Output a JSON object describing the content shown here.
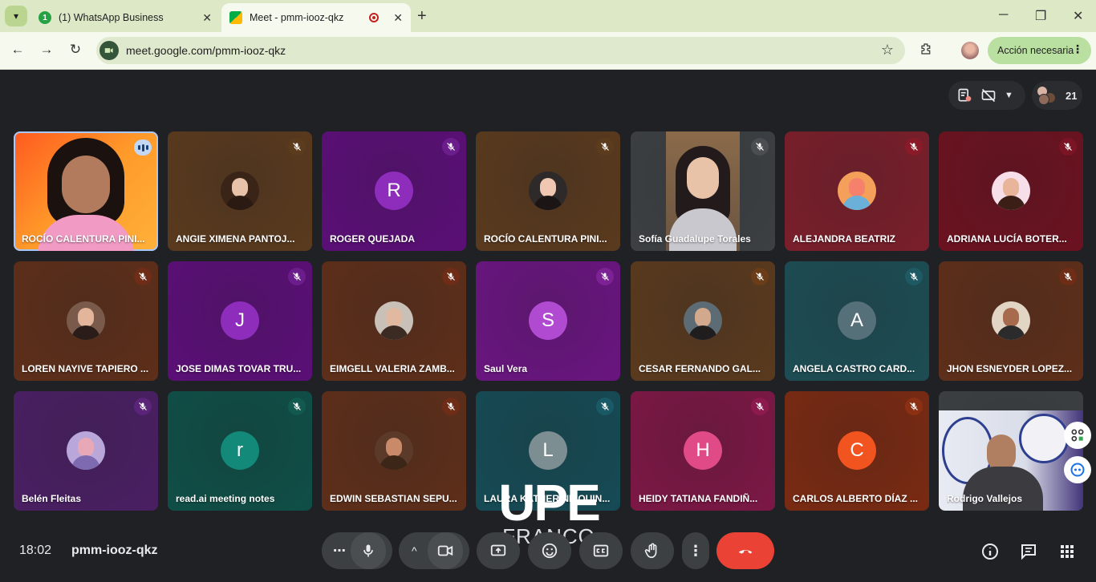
{
  "browser": {
    "tabs": [
      {
        "title": "(1) WhatsApp Business",
        "favicon_badge": "1"
      },
      {
        "title": "Meet - pmm-iooz-qkz"
      }
    ],
    "url": "meet.google.com/pmm-iooz-qkz",
    "action_button": "Acción necesaria"
  },
  "meet": {
    "participant_count": "21",
    "time": "18:02",
    "code": "pmm-iooz-qkz"
  },
  "tiles": [
    {
      "name": "ROCÍO CALENTURA PINI...",
      "bg": "#ff8a1f",
      "kind": "video-main"
    },
    {
      "name": "ANGIE XIMENA PANTOJ...",
      "bg": "#5a3a1e",
      "kind": "photo",
      "mic": "#5c3c1d"
    },
    {
      "name": "ROGER QUEJADA",
      "bg": "#5b0f77",
      "kind": "letter",
      "letter": "R",
      "avatar_color": "#8e2dbb",
      "mic": "#6c1d8c"
    },
    {
      "name": "ROCÍO CALENTURA PINI...",
      "bg": "#5a3a1e",
      "kind": "photo",
      "mic": "#5c3c1d"
    },
    {
      "name": "Sofía Guadalupe Torales",
      "bg": "#3c4043",
      "kind": "video-side",
      "mic": "#4a4d51"
    },
    {
      "name": "ALEJANDRA BEATRIZ",
      "bg": "#7a1f2b",
      "kind": "photo",
      "mic": "#8a1a28"
    },
    {
      "name": "ADRIANA LUCÍA BOTER...",
      "bg": "#6c1220",
      "kind": "photo",
      "mic": "#7b1424"
    },
    {
      "name": "LOREN NAYIVE TAPIERO ...",
      "bg": "#5e2f1a",
      "kind": "photo",
      "mic": "#6f2c17"
    },
    {
      "name": "JOSE DIMAS TOVAR TRU...",
      "bg": "#5b0f77",
      "kind": "letter",
      "letter": "J",
      "avatar_color": "#8e2dbb",
      "mic": "#6c1d8c"
    },
    {
      "name": "EIMGELL VALERIA ZAMB...",
      "bg": "#5e2f1a",
      "kind": "photo",
      "mic": "#6f2c17"
    },
    {
      "name": "Saul Vera",
      "bg": "#6a1580",
      "kind": "letter",
      "letter": "S",
      "avatar_color": "#b04bd1",
      "mic": "#7c2295"
    },
    {
      "name": "CESAR FERNANDO GAL...",
      "bg": "#5a3a1e",
      "kind": "photo",
      "mic": "#6a3c17"
    },
    {
      "name": "ANGELA CASTRO CARD...",
      "bg": "#1d4d54",
      "kind": "letter",
      "letter": "A",
      "avatar_color": "#56707a",
      "mic": "#1e5a63"
    },
    {
      "name": "JHON ESNEYDER LOPEZ...",
      "bg": "#5e2f1a",
      "kind": "photo",
      "mic": "#6f2c17"
    },
    {
      "name": "Belén Fleitas",
      "bg": "#4a1f63",
      "kind": "photo",
      "mic": "#5a2478"
    },
    {
      "name": "read.ai meeting notes",
      "bg": "#0f4f47",
      "kind": "letter",
      "letter": "r",
      "avatar_color": "#13897a",
      "mic": "#125a50"
    },
    {
      "name": "EDWIN SEBASTIAN SEPU...",
      "bg": "#5e2f1a",
      "kind": "photo",
      "mic": "#6f2c17"
    },
    {
      "name": "LAURA KATHERINE QUIN...",
      "bg": "#164b55",
      "kind": "letter",
      "letter": "L",
      "avatar_color": "#7d8e93",
      "mic": "#1a5a66"
    },
    {
      "name": "HEIDY TATIANA FANDIÑ...",
      "bg": "#7c1745",
      "kind": "letter",
      "letter": "H",
      "avatar_color": "#e04a86",
      "mic": "#8c1a4e"
    },
    {
      "name": "CARLOS ALBERTO DÍAZ ...",
      "bg": "#7a2a12",
      "kind": "letter",
      "letter": "C",
      "avatar_color": "#f2541f",
      "mic": "#8c3013"
    },
    {
      "name": "Rodrigo Vallejos",
      "bg": "#3c4043",
      "kind": "video-office"
    }
  ],
  "watermark": {
    "line1": "UPE",
    "line2": "FRANCO"
  },
  "colors": {
    "end_call": "#ea4335",
    "control_bg": "#3c4043",
    "meet_bg": "#202124"
  }
}
